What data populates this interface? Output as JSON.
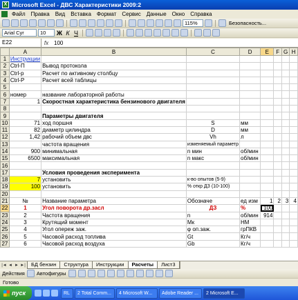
{
  "window": {
    "title": "Microsoft Excel - ДВС Характеристики 2009:2"
  },
  "menu": [
    "Файл",
    "Правка",
    "Вид",
    "Вставка",
    "Формат",
    "Сервис",
    "Данные",
    "Окно",
    "Справка"
  ],
  "toolbar": {
    "zoom": "115%",
    "security": "Безопасность..."
  },
  "format_toolbar": {
    "font": "Arial Cyr",
    "size": "10",
    "bold": "Ж",
    "italic": "К",
    "underline": "Ч"
  },
  "formula_bar": {
    "cell": "E22",
    "fx": "fx",
    "value": "100"
  },
  "columns": [
    "A",
    "B",
    "C",
    "D",
    "E",
    "F",
    "G",
    "H"
  ],
  "rows": [
    {
      "n": "1",
      "a": "Инструкции",
      "b": "",
      "c": "",
      "d": "",
      "e": "",
      "f": "",
      "g": "",
      "h": ""
    },
    {
      "n": "2",
      "a": "Ctrl-П",
      "b": "Вывод протокола",
      "c": "",
      "d": "",
      "e": "",
      "f": "",
      "g": "",
      "h": ""
    },
    {
      "n": "3",
      "a": "Ctrl-р",
      "b": "Расчет по активному столбцу",
      "c": "",
      "d": "",
      "e": "",
      "f": "",
      "g": "",
      "h": ""
    },
    {
      "n": "4",
      "a": "Ctrl-Р",
      "b": "Расчет всей таблицы",
      "c": "",
      "d": "",
      "e": "",
      "f": "",
      "g": "",
      "h": ""
    },
    {
      "n": "5",
      "a": "",
      "b": "",
      "c": "",
      "d": "",
      "e": "",
      "f": "",
      "g": "",
      "h": ""
    },
    {
      "n": "6",
      "a": "номер",
      "b": "название лабораторной работы",
      "c": "",
      "d": "",
      "e": "",
      "f": "",
      "g": "",
      "h": ""
    },
    {
      "n": "7",
      "a": "1",
      "b": "Скоростная характеристика бензинового двигателя",
      "c": "",
      "d": "",
      "e": "",
      "f": "",
      "g": "",
      "h": ""
    },
    {
      "n": "8",
      "a": "",
      "b": "",
      "c": "",
      "d": "",
      "e": "",
      "f": "",
      "g": "",
      "h": ""
    },
    {
      "n": "9",
      "a": "",
      "b": "Параметры двигателя",
      "c": "",
      "d": "",
      "e": "",
      "f": "",
      "g": "",
      "h": ""
    },
    {
      "n": "10",
      "a": "71",
      "b": "ход поршня",
      "c": "S",
      "d": "мм",
      "e": "",
      "f": "",
      "g": "",
      "h": ""
    },
    {
      "n": "11",
      "a": "82",
      "b": "диаметр цилиндра",
      "c": "D",
      "d": "мм",
      "e": "",
      "f": "",
      "g": "",
      "h": ""
    },
    {
      "n": "12",
      "a": "1,42",
      "b": "рабочий объем двс",
      "c": "Vh",
      "d": "л",
      "e": "",
      "f": "",
      "g": "",
      "h": ""
    },
    {
      "n": "13",
      "a": "",
      "b": "частота вращения",
      "c": "изменяемый параметр",
      "d": "",
      "e": "",
      "f": "",
      "g": "",
      "h": ""
    },
    {
      "n": "14",
      "a": "900",
      "b": "минимальная",
      "c": "n мин",
      "d": "об/мин",
      "e": "",
      "f": "",
      "g": "",
      "h": ""
    },
    {
      "n": "15",
      "a": "6500",
      "b": "максимальная",
      "c": "n макс",
      "d": "об/мин",
      "e": "",
      "f": "",
      "g": "",
      "h": ""
    },
    {
      "n": "16",
      "a": "",
      "b": "",
      "c": "",
      "d": "",
      "e": "",
      "f": "",
      "g": "",
      "h": ""
    },
    {
      "n": "17",
      "a": "",
      "b": "Условия проведения эксперимента",
      "c": "",
      "d": "",
      "e": "",
      "f": "",
      "g": "",
      "h": ""
    },
    {
      "n": "18",
      "a": "7",
      "b": "установить",
      "c": "к-во опытов (5-9)",
      "d": "",
      "e": "",
      "f": "",
      "g": "",
      "h": ""
    },
    {
      "n": "19",
      "a": "100",
      "b": "установить",
      "c": "% откр ДЗ (10-100)",
      "d": "",
      "e": "",
      "f": "",
      "g": "",
      "h": ""
    },
    {
      "n": "20",
      "a": "",
      "b": "",
      "c": "",
      "d": "",
      "e": "",
      "f": "",
      "g": "",
      "h": ""
    },
    {
      "n": "21",
      "a": "№",
      "b": "Название параметра",
      "c": "Обозначе",
      "d": "ед изм",
      "e": "1",
      "f": "2",
      "g": "3",
      "h": "4"
    },
    {
      "n": "22",
      "a": "1",
      "b": "Угол поворота др.засл",
      "c": "ДЗ",
      "d": "%",
      "e": "100",
      "f": "",
      "g": "",
      "h": ""
    },
    {
      "n": "23",
      "a": "2",
      "b": "Частота вращения",
      "c": "n",
      "d": "об/мин",
      "e": "914",
      "f": "",
      "g": "",
      "h": ""
    },
    {
      "n": "24",
      "a": "3",
      "b": "Крутящий момент",
      "c": "Мк",
      "d": "НМ",
      "e": "",
      "f": "",
      "g": "",
      "h": ""
    },
    {
      "n": "25",
      "a": "4",
      "b": "Угол опереж заж.",
      "c": "φ оп.заж.",
      "d": "грПКВ",
      "e": "",
      "f": "",
      "g": "",
      "h": ""
    },
    {
      "n": "26",
      "a": "5",
      "b": "Часовой расход топлива",
      "c": "Gt",
      "d": "Кг/ч",
      "e": "",
      "f": "",
      "g": "",
      "h": ""
    },
    {
      "n": "27",
      "a": "6",
      "b": "Часовой расход воздуха",
      "c": "Gb",
      "d": "Кг/ч",
      "e": "",
      "f": "",
      "g": "",
      "h": ""
    }
  ],
  "sheet_tabs": [
    "БД бензин",
    "Структура",
    "Инструкции",
    "Расчеты",
    "Лист3"
  ],
  "active_tab": "Расчеты",
  "draw_toolbar": {
    "actions": "Действия",
    "autoshapes": "Автофигуры"
  },
  "status": "Готово",
  "taskbar": {
    "start": "пуск",
    "tasks": [
      "RL",
      "2 Total Comm...",
      "4 Microsoft W...",
      "Adobe Reader ...",
      "2 Microsoft E..."
    ]
  }
}
